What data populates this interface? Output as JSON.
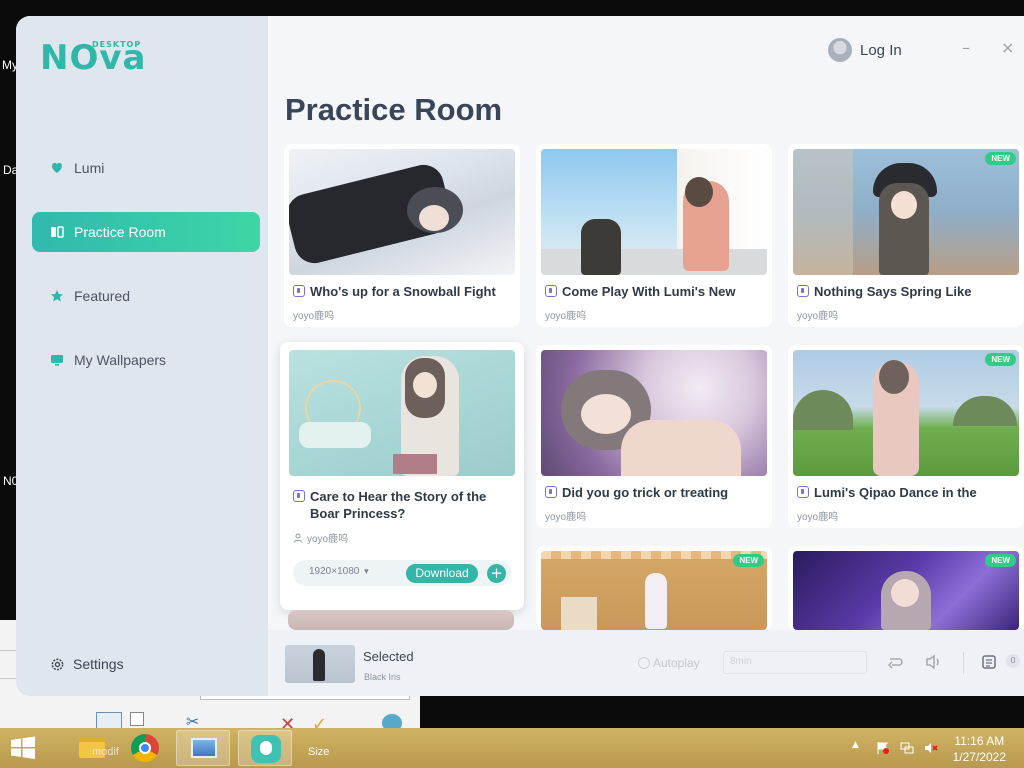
{
  "desktop": {
    "labels": [
      "My",
      "Da",
      "N0"
    ],
    "toolbar_label": "Size",
    "partial_text": "modif"
  },
  "app": {
    "logo_main": "NOva",
    "logo_sub": "DESKTOP",
    "login_label": "Log In",
    "minimize": "–",
    "close": "×"
  },
  "sidebar": {
    "items": [
      {
        "label": "Lumi",
        "icon": "heart-icon"
      },
      {
        "label": "Practice Room",
        "icon": "book-icon",
        "active": true
      },
      {
        "label": "Featured",
        "icon": "star-icon"
      },
      {
        "label": "My Wallpapers",
        "icon": "monitor-icon"
      }
    ],
    "settings_label": "Settings"
  },
  "page_title": "Practice Room",
  "cards": [
    {
      "title": "Who's up for a Snowball Fight",
      "author": "yoyo鹿呜",
      "new": false
    },
    {
      "title": "Come Play With Lumi's New",
      "author": "yoyo鹿呜",
      "new": false
    },
    {
      "title": "Nothing Says Spring Like",
      "author": "yoyo鹿呜",
      "new": true
    },
    {
      "title": "Care to Hear the Story of the Boar Princess?",
      "author": "yoyo鹿呜",
      "new": false
    },
    {
      "title": "Did you go trick or treating",
      "author": "yoyo鹿呜",
      "new": false
    },
    {
      "title": "Lumi's Qipao Dance in the",
      "author": "yoyo鹿呜",
      "new": true
    },
    {
      "title": "",
      "author": "",
      "new": false
    },
    {
      "title": "",
      "author": "",
      "new": true
    },
    {
      "title": "",
      "author": "",
      "new": true
    }
  ],
  "badge_text": "NEW",
  "expanded_card": {
    "resolution": "1920×1080",
    "download_label": "Download",
    "add_label": "+"
  },
  "player": {
    "selected_label": "Selected",
    "selected_name": "Black Iris",
    "autoplay_label": "Autoplay",
    "field_placeholder": "8min",
    "count": "0"
  },
  "taskbar": {
    "time": "11:16 AM",
    "date": "1/27/2022"
  },
  "colors": {
    "accent": "#35b4a8",
    "badge": "#2fcc86",
    "sidebar": "#dfe6ee",
    "taskbar": "#c4a65a"
  }
}
